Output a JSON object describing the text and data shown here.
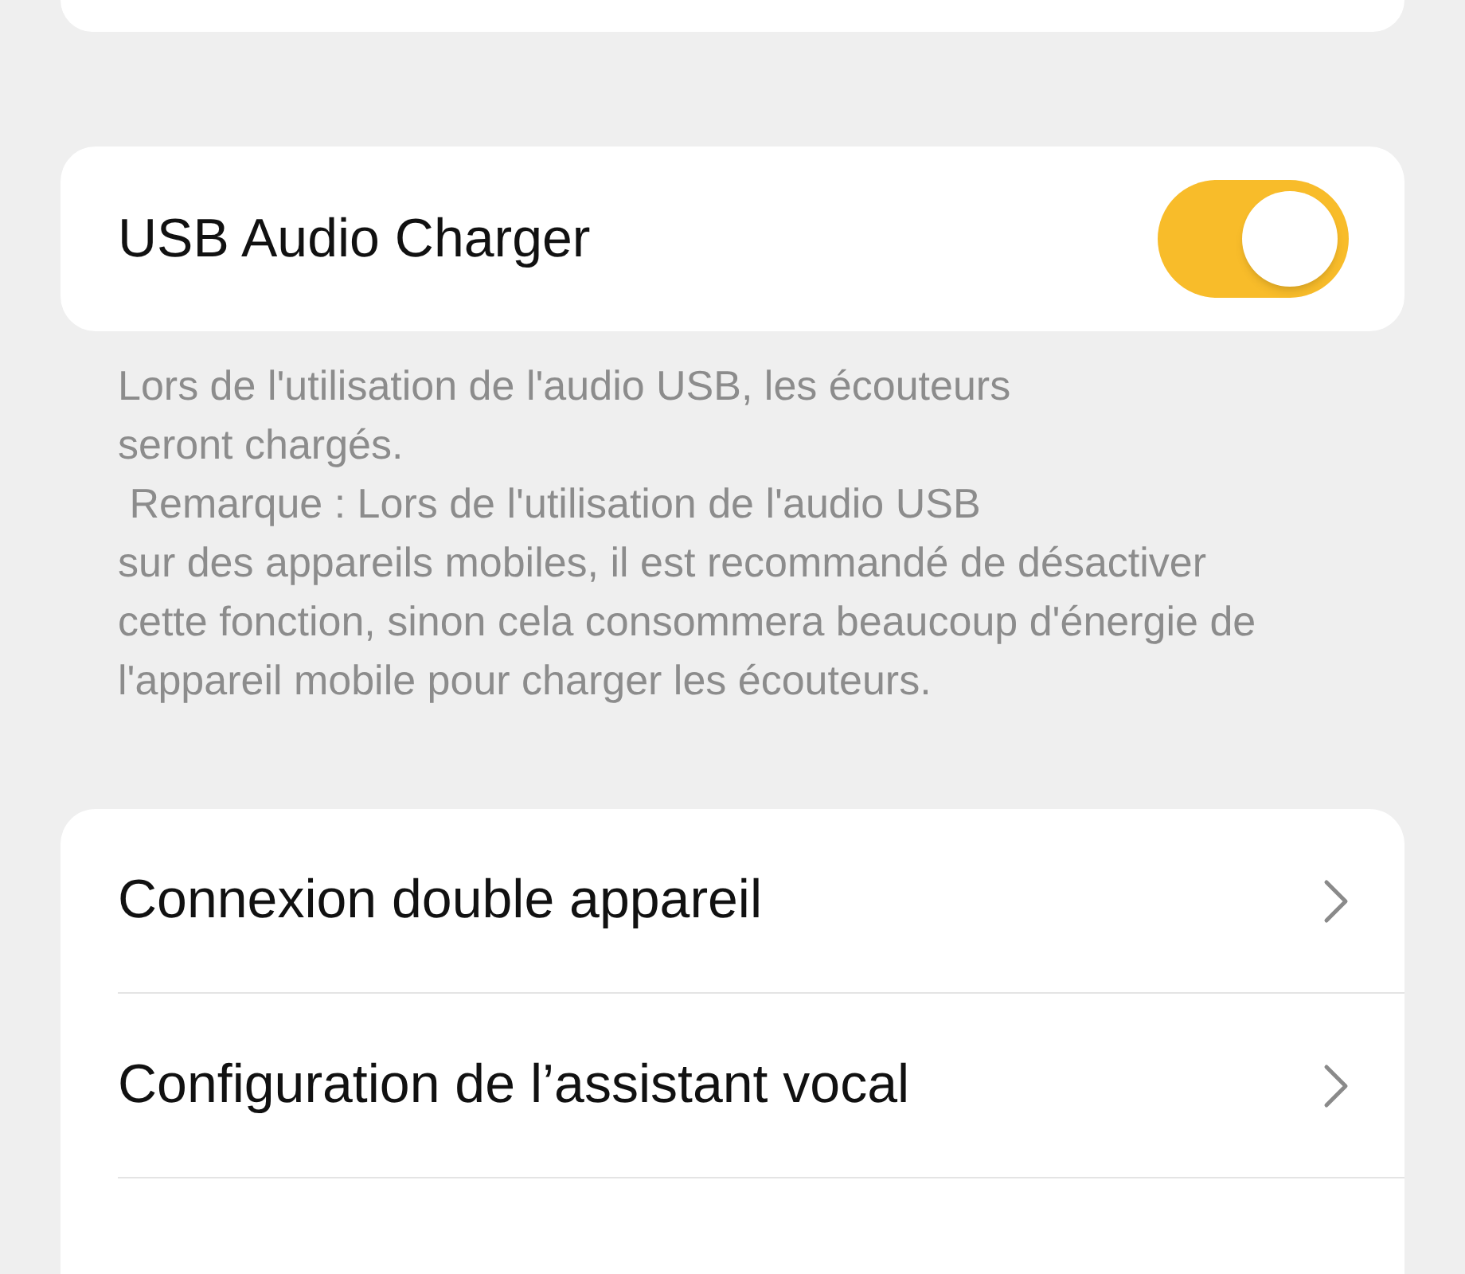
{
  "usb_audio_charger": {
    "label": "USB Audio Charger",
    "on": true
  },
  "description": "Lors de l'utilisation de l'audio USB, les écouteurs\nseront chargés.\n Remarque : Lors de l'utilisation de l'audio USB\nsur des appareils mobiles, il est recommandé de désactiver cette fonction, sinon cela consommera beaucoup d'énergie de l'appareil mobile pour charger les écouteurs.",
  "menu_items": [
    {
      "label": "Connexion double appareil"
    },
    {
      "label": "Configuration de l’assistant vocal"
    }
  ]
}
